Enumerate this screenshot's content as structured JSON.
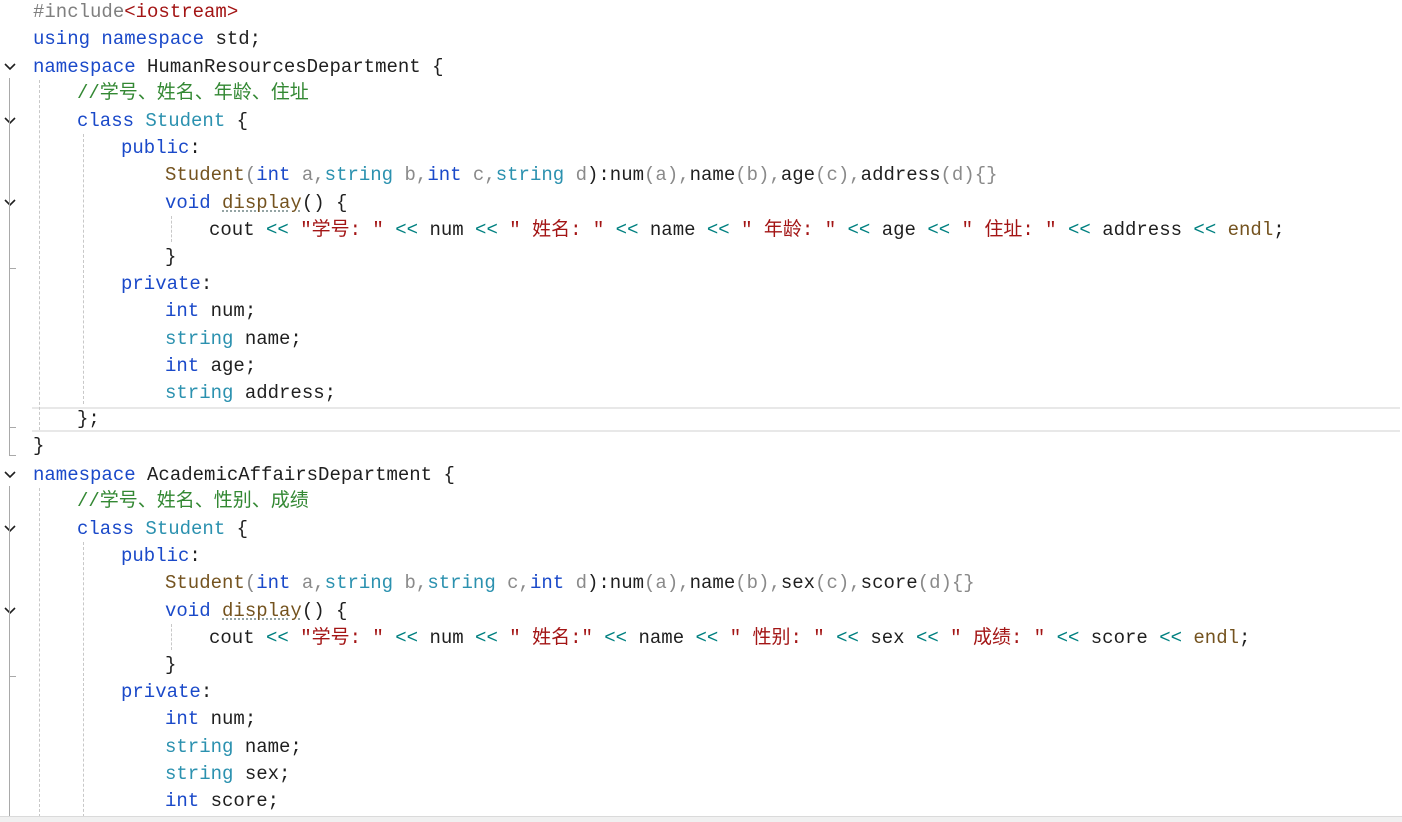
{
  "editor": {
    "lines": {
      "l1": {
        "pp": "#include",
        "inc": "<iostream>"
      },
      "l2": {
        "kw1": "using",
        "kw2": "namespace",
        "rest": " std;"
      },
      "l3": {
        "kw": "namespace",
        "name": " HumanResourcesDepartment {"
      },
      "l4": {
        "comment": "//学号、姓名、年龄、住址"
      },
      "l5": {
        "kw": "class",
        "type": "Student",
        "rest": " {"
      },
      "l6": {
        "kw": "public",
        "rest": ":"
      },
      "l7": {
        "fn": "Student",
        "p1": "(",
        "k1": "int",
        "a": " a,",
        "t1": "string",
        "b": " b,",
        "k2": "int",
        "c": " c,",
        "t2": "string",
        "d": " d",
        "p2": "):",
        "num": "num",
        "pa": "(a),",
        "name": "name",
        "pb": "(b),",
        "age": "age",
        "pc": "(c),",
        "addr": "address",
        "pd": "(d){}"
      },
      "l8": {
        "kw": "void",
        "fn": "display",
        "rest": "() {"
      },
      "l9": {
        "cout": "cout",
        "op1": " << ",
        "s1": "\"学号: \"",
        "op2": " << ",
        "v1": "num",
        "op3": " << ",
        "s2": "\" 姓名: \"",
        "op4": " << ",
        "v2": "name",
        "op5": " << ",
        "s3": "\" 年龄: \"",
        "op6": " << ",
        "v3": "age",
        "op7": " << ",
        "s4": "\" 住址: \"",
        "op8": " << ",
        "v4": "address",
        "op9": " << ",
        "endl": "endl",
        "end": ";"
      },
      "l10": {
        "text": "}"
      },
      "l11": {
        "kw": "private",
        "rest": ":"
      },
      "l12": {
        "type": "int",
        "rest": " num;"
      },
      "l13": {
        "type": "string",
        "rest": " name;"
      },
      "l14": {
        "type": "int",
        "rest": " age;"
      },
      "l15": {
        "type": "string",
        "rest": " address;"
      },
      "l16": {
        "text": "};"
      },
      "l17": {
        "text": "}"
      },
      "l18": {
        "kw": "namespace",
        "name": " AcademicAffairsDepartment {"
      },
      "l19": {
        "comment": "//学号、姓名、性别、成绩"
      },
      "l20": {
        "kw": "class",
        "type": "Student",
        "rest": " {"
      },
      "l21": {
        "kw": "public",
        "rest": ":"
      },
      "l22": {
        "fn": "Student",
        "p1": "(",
        "k1": "int",
        "a": " a,",
        "t1": "string",
        "b": " b,",
        "t2": "string",
        "c": " c,",
        "k2": "int",
        "d": " d",
        "p2": "):",
        "num": "num",
        "pa": "(a),",
        "name": "name",
        "pb": "(b),",
        "sex": "sex",
        "pc": "(c),",
        "score": "score",
        "pd": "(d){}"
      },
      "l23": {
        "kw": "void",
        "fn": "display",
        "rest": "() {"
      },
      "l24": {
        "cout": "cout",
        "op1": " << ",
        "s1": "\"学号: \"",
        "op2": " << ",
        "v1": "num",
        "op3": " << ",
        "s2": "\" 姓名:\"",
        "op4": " << ",
        "v2": "name",
        "op5": " << ",
        "s3": "\" 性别: \"",
        "op6": " << ",
        "v3": "sex",
        "op7": " << ",
        "s4": "\" 成绩: \"",
        "op8": " << ",
        "v4": "score",
        "op9": " << ",
        "endl": "endl",
        "end": ";"
      },
      "l25": {
        "text": "}"
      },
      "l26": {
        "kw": "private",
        "rest": ":"
      },
      "l27": {
        "type": "int",
        "rest": " num;"
      },
      "l28": {
        "type": "string",
        "rest": " name;"
      },
      "l29": {
        "type": "string",
        "rest": " sex;"
      },
      "l30": {
        "type": "int",
        "rest": " score;"
      }
    }
  }
}
